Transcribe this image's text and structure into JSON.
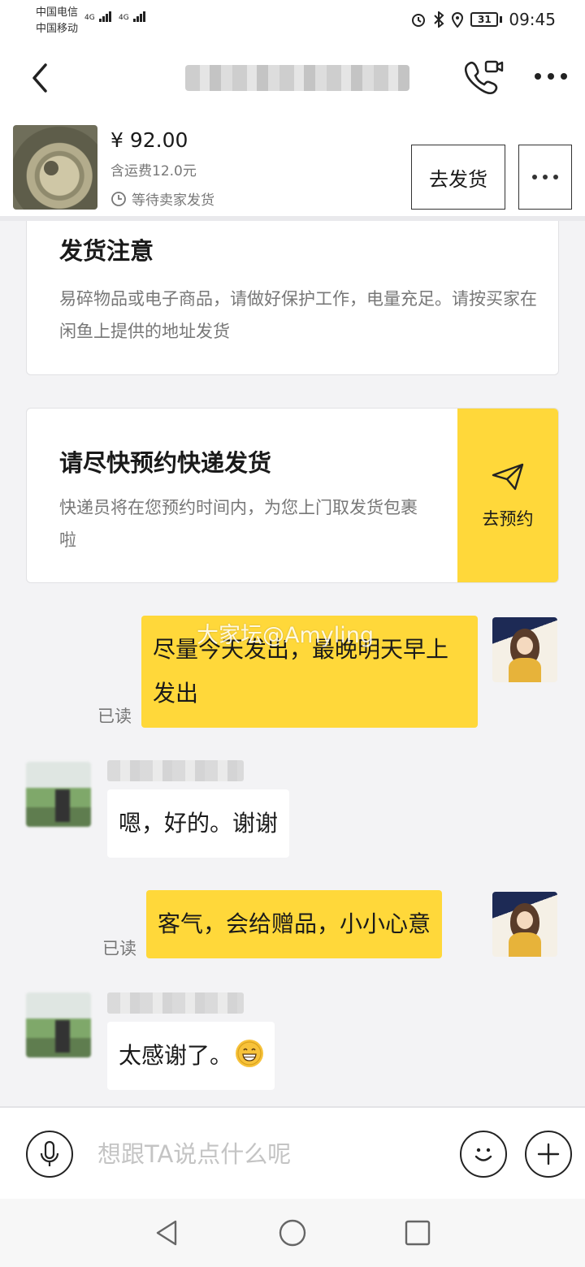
{
  "status_bar": {
    "carrier_1": "中国电信",
    "carrier_2": "中国移动",
    "network_1": "4G",
    "network_2": "4G",
    "battery": "31",
    "time": "09:45"
  },
  "header": {
    "title": "██████ ██ ██"
  },
  "order": {
    "price": "¥ 92.00",
    "shipping": "含运费12.0元",
    "status": "等待卖家发货",
    "ship_button": "去发货"
  },
  "notice_card": {
    "title": "发货注意",
    "body": "易碎物品或电子商品，请做好保护工作，电量充足。请按买家在闲鱼上提供的地址发货"
  },
  "pickup_card": {
    "title": "请尽快预约快递发货",
    "body": "快递员将在您预约时间内，为您上门取发货包裹啦",
    "button": "去预约"
  },
  "messages": [
    {
      "from": "self",
      "text": "尽量今天发出，最晚明天早上发出",
      "read": "已读"
    },
    {
      "from": "peer",
      "text": "嗯，好的。谢谢"
    },
    {
      "from": "self",
      "text": "客气，会给赠品，小小心意",
      "read": "已读"
    },
    {
      "from": "peer",
      "text": "太感谢了。",
      "emoji": "grin-emoji"
    }
  ],
  "watermark": "大家坛@Amyling",
  "input": {
    "placeholder": "想跟TA说点什么呢"
  },
  "icons": {
    "back": "back-chevron-icon",
    "video_call": "video-call-icon",
    "more": "more-dots-icon",
    "clock": "clock-icon",
    "send": "paper-plane-icon",
    "voice": "microphone-icon",
    "emoji": "smiley-icon",
    "plus": "plus-icon"
  },
  "colors": {
    "accent_yellow": "#ffd83a",
    "background": "#f3f3f5",
    "muted_text": "#777777"
  }
}
